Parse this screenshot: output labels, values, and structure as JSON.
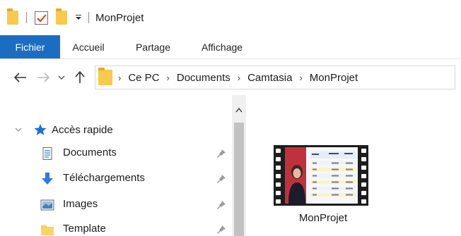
{
  "window": {
    "title": "MonProjet"
  },
  "ribbon": {
    "tabs": [
      {
        "label": "Fichier",
        "active": true
      },
      {
        "label": "Accueil"
      },
      {
        "label": "Partage"
      },
      {
        "label": "Affichage"
      }
    ]
  },
  "address": {
    "breadcrumbs": [
      "Ce PC",
      "Documents",
      "Camtasia",
      "MonProjet"
    ]
  },
  "navpane": {
    "quick_access_label": "Accès rapide",
    "items": [
      {
        "label": "Documents",
        "icon": "documents-icon",
        "pinned": true
      },
      {
        "label": "Téléchargements",
        "icon": "downloads-icon",
        "pinned": true
      },
      {
        "label": "Images",
        "icon": "images-icon",
        "pinned": true
      },
      {
        "label": "Template",
        "icon": "folder-icon",
        "pinned": true
      }
    ]
  },
  "content": {
    "files": [
      {
        "name": "MonProjet",
        "type": "video",
        "icon": "video-file-thumbnail"
      }
    ]
  },
  "colors": {
    "file_tab": "#1a6dc2",
    "folder": "#f8c94a",
    "quick_access_star": "#1a73d9",
    "download_arrow": "#2b7be0",
    "scrollbar_thumb": "#c2c2c2"
  }
}
